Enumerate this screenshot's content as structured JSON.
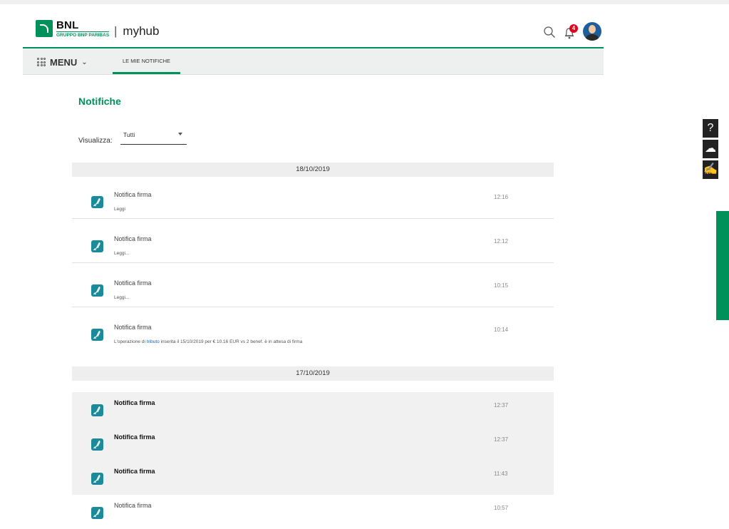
{
  "header": {
    "logo_text": "BNL",
    "logo_sub": "GRUPPO BNP PARIBAS",
    "separator": "|",
    "app_name": "myhub",
    "notification_count": "4"
  },
  "menubar": {
    "menu_label": "MENU",
    "tab_label": "LE MIE NOTIFICHE"
  },
  "page": {
    "title": "Notifiche",
    "filter_label": "Visualizza:",
    "filter_value": "Tutti"
  },
  "groups": [
    {
      "date": "18/10/2019",
      "items": [
        {
          "title": "Notifica firma",
          "sub": "Leggi",
          "time": "12:16",
          "unread": false
        },
        {
          "title": "Notifica firma",
          "sub": "Leggi...",
          "time": "12:12",
          "unread": false
        },
        {
          "title": "Notifica firma",
          "sub": "Leggi...",
          "time": "10:15",
          "unread": false
        },
        {
          "title": "Notifica firma",
          "sub_prefix": "L'operazione di ",
          "sub_link": "tributo",
          "sub_suffix": " inserita il 15/10/2019 per € 10.16 EUR vs 2 benef. è in attesa di firma",
          "time": "10:14",
          "unread": false
        }
      ]
    },
    {
      "date": "17/10/2019",
      "items": [
        {
          "title": "Notifica firma",
          "time": "12:37",
          "unread": true
        },
        {
          "title": "Notifica firma",
          "time": "12:37",
          "unread": true
        },
        {
          "title": "Notifica firma",
          "time": "11:43",
          "unread": true
        },
        {
          "title": "Notifica firma",
          "time": "10:57",
          "unread": false
        }
      ]
    }
  ],
  "side_tools": [
    {
      "icon": "help-icon",
      "glyph": "?"
    },
    {
      "icon": "cloud-upload-icon",
      "glyph": "☁"
    },
    {
      "icon": "signature-icon",
      "glyph": "✍"
    }
  ],
  "colors": {
    "brand_green": "#00915a",
    "badge_red": "#e2001a",
    "notif_icon": "#1b8a9a",
    "link_blue": "#1565c0"
  }
}
